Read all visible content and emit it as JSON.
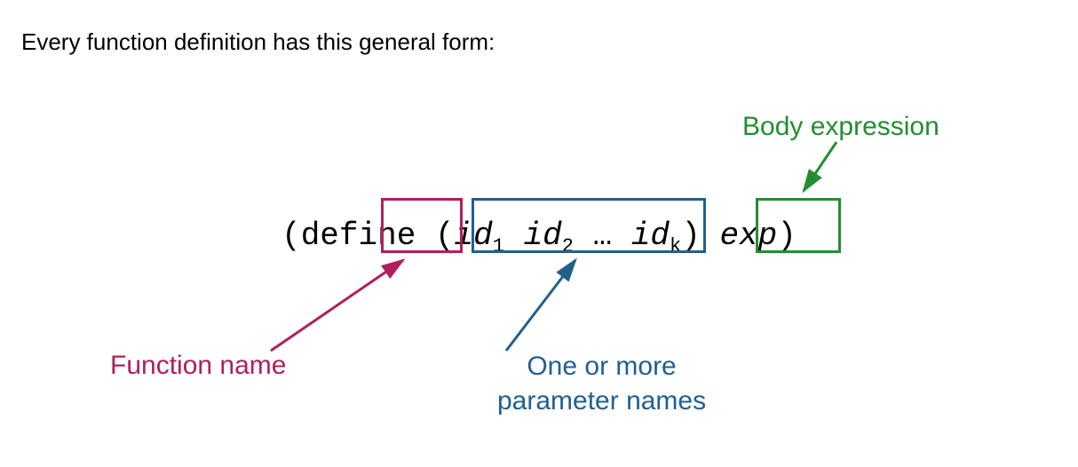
{
  "intro": "Every function definition has this general form:",
  "syntax": {
    "openParen1": "(",
    "define": "define",
    "space1": " ",
    "openParen2": "(",
    "id1": "id",
    "sub1": "1",
    "space3": " ",
    "id2": "id",
    "sub2": "2",
    "space4": " ",
    "ellipsis": "…",
    "space5": " ",
    "idk": "id",
    "subk": "k",
    "closeParen1": ")",
    "space6": " ",
    "exp": "exp",
    "closeParen2": ")"
  },
  "labels": {
    "functionName": "Function name",
    "params": "One or more\nparameter names",
    "bodyExpression": "Body expression"
  },
  "colors": {
    "funcName": "#b01f5d",
    "params": "#20608f",
    "body": "#238e32"
  }
}
